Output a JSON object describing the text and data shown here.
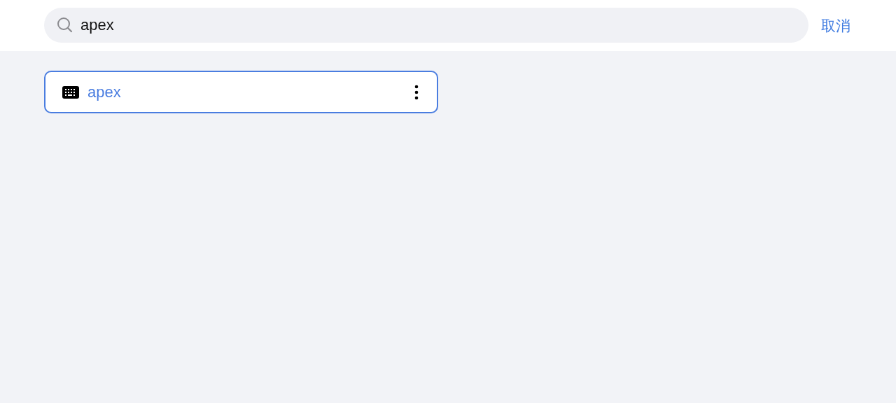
{
  "search": {
    "value": "apex"
  },
  "cancel": {
    "label": "取消"
  },
  "results": [
    {
      "label": "apex",
      "selected": true
    }
  ]
}
